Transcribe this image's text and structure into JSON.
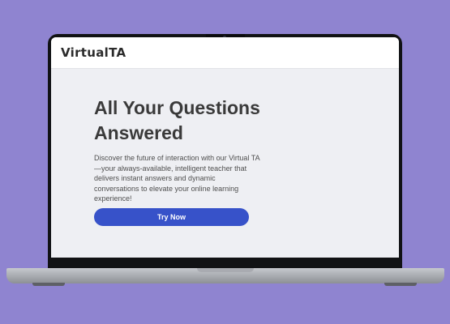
{
  "header": {
    "logo_text": "VirtualTA"
  },
  "hero": {
    "title_line1": "All Your Questions",
    "title_line2": "Answered",
    "description": "Discover the future of interaction with our Virtual TA—your always-available, intelligent teacher that delivers instant answers and dynamic conversations to elevate your online learning experience!",
    "cta_label": "Try Now"
  },
  "colors": {
    "background": "#8f84d0",
    "accent": "#3752c9",
    "screen": "#eeeff3",
    "heading_text": "#3a3a3a"
  }
}
